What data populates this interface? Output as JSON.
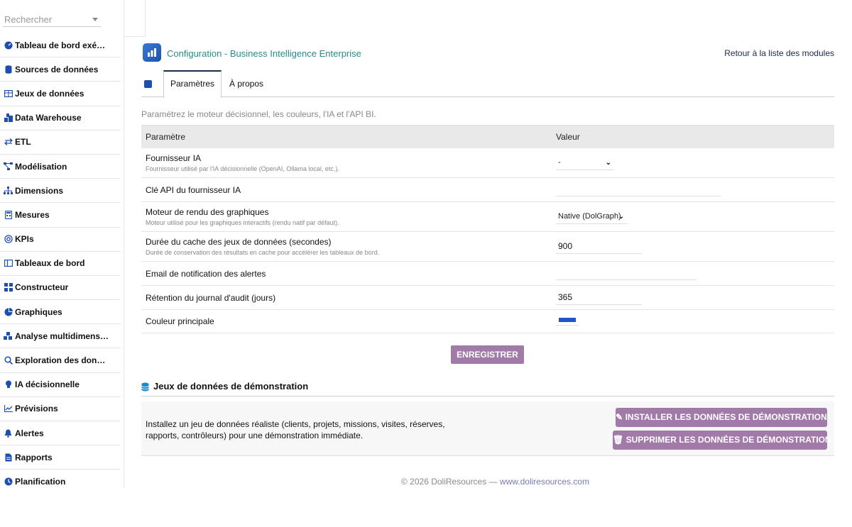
{
  "search": {
    "placeholder": "Rechercher"
  },
  "sidebar": {
    "items": [
      {
        "label": "Tableau de bord exé…",
        "icon": "gauge-icon"
      },
      {
        "label": "Sources de données",
        "icon": "database-icon"
      },
      {
        "label": "Jeux de données",
        "icon": "table-icon"
      },
      {
        "label": "Data Warehouse",
        "icon": "warehouse-icon"
      },
      {
        "label": "ETL",
        "icon": "arrows-exchange-icon"
      },
      {
        "label": "Modélisation",
        "icon": "diagram-icon"
      },
      {
        "label": "Dimensions",
        "icon": "hierarchy-icon"
      },
      {
        "label": "Mesures",
        "icon": "calculator-icon"
      },
      {
        "label": "KPIs",
        "icon": "target-icon"
      },
      {
        "label": "Tableaux de bord",
        "icon": "columns-icon"
      },
      {
        "label": "Constructeur",
        "icon": "grid-icon"
      },
      {
        "label": "Graphiques",
        "icon": "pie-chart-icon"
      },
      {
        "label": "Analyse multidimens…",
        "icon": "cubes-icon"
      },
      {
        "label": "Exploration des don…",
        "icon": "magnifier-icon"
      },
      {
        "label": "IA décisionnelle",
        "icon": "lightbulb-icon"
      },
      {
        "label": "Prévisions",
        "icon": "line-chart-icon"
      },
      {
        "label": "Alertes",
        "icon": "bell-icon"
      },
      {
        "label": "Rapports",
        "icon": "document-icon"
      },
      {
        "label": "Planification",
        "icon": "clock-icon"
      }
    ]
  },
  "header": {
    "title": "Configuration - Business Intelligence Enterprise",
    "back_link": "Retour à la liste des modules"
  },
  "tabs": [
    {
      "label": "Paramètres",
      "active": true
    },
    {
      "label": "À propos",
      "active": false
    }
  ],
  "description": "Paramétrez le moteur décisionnel, les couleurs, l'IA et l'API BI.",
  "table": {
    "col_param": "Paramètre",
    "col_value": "Valeur",
    "rows": [
      {
        "name": "Fournisseur IA",
        "desc": "Fournisseur utilisé par l'IA décisionnelle (OpenAI, Ollama local, etc.).",
        "value": "-",
        "type": "select"
      },
      {
        "name": "Clé API du fournisseur IA",
        "desc": "",
        "value": "",
        "type": "input"
      },
      {
        "name": "Moteur de rendu des graphiques",
        "desc": "Moteur utilisé pour les graphiques interactifs (rendu natif par défaut).",
        "value": "Native (DolGraph)",
        "type": "select"
      },
      {
        "name": "Durée du cache des jeux de données (secondes)",
        "desc": "Durée de conservation des résultats en cache pour accélérer les tableaux de bord.",
        "value": "900",
        "type": "input"
      },
      {
        "name": "Email de notification des alertes",
        "desc": "",
        "value": "",
        "type": "input"
      },
      {
        "name": "Rétention du journal d'audit (jours)",
        "desc": "",
        "value": "365",
        "type": "input"
      },
      {
        "name": "Couleur principale",
        "desc": "",
        "value": "#2352c9",
        "type": "color"
      }
    ]
  },
  "save_label": "ENREGISTRER",
  "demo": {
    "title": "Jeux de données de démonstration",
    "text": "Installez un jeu de données réaliste (clients, projets, missions, visites, réserves, rapports, contrôleurs) pour une démonstration immédiate.",
    "install_label": "INSTALLER LES DONNÉES DE DÉMONSTRATION",
    "delete_label": "SUPPRIMER LES DONNÉES DE DÉMONSTRATION"
  },
  "footer": {
    "copyright": "© 2026 DoliResources —",
    "url": "www.doliresources.com"
  },
  "colors": {
    "accent": "#a17aa9",
    "title": "#2a8a8a",
    "icon": "#1d4fb0"
  }
}
